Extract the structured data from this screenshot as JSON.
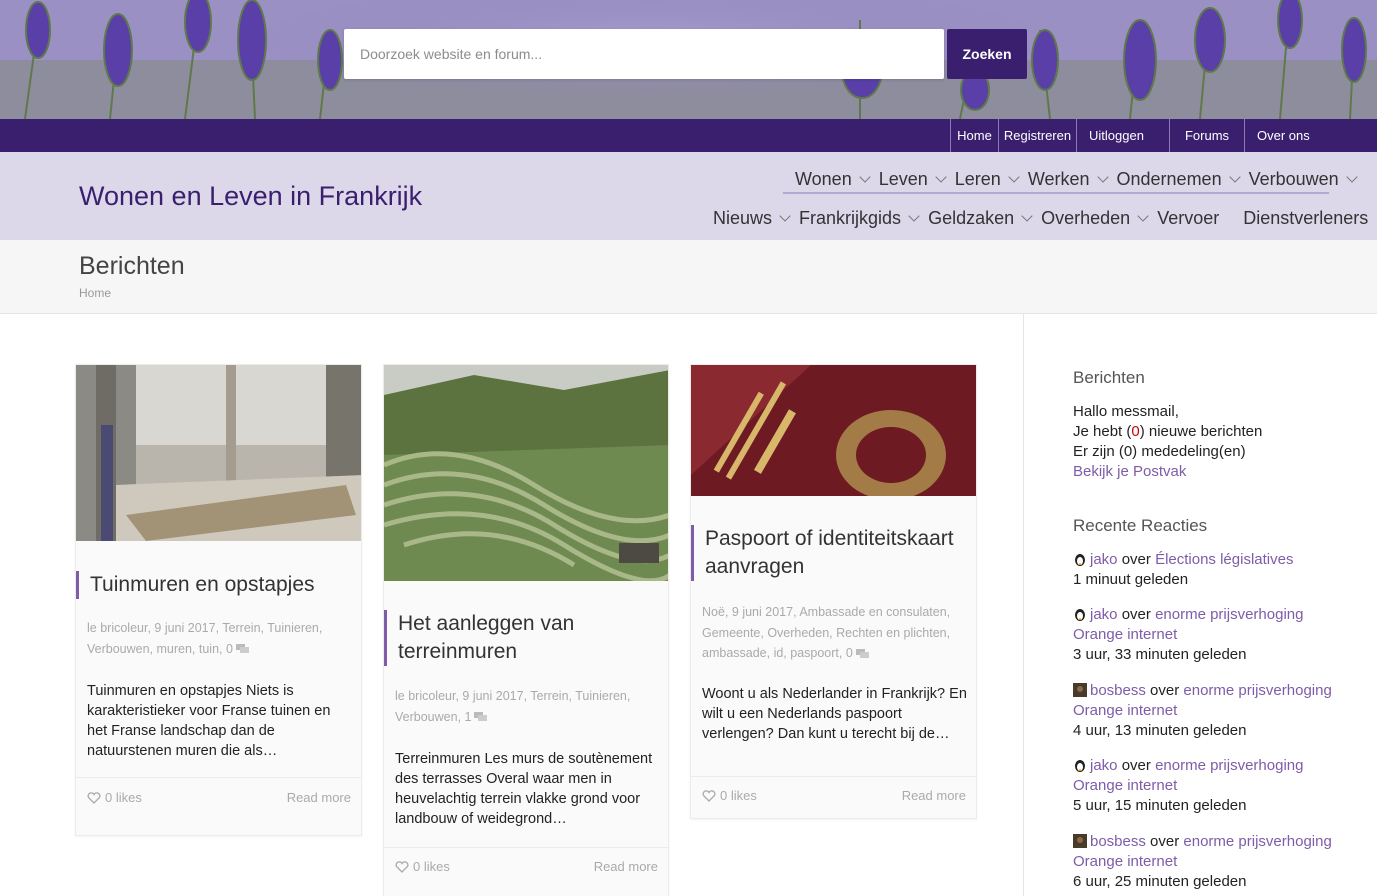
{
  "search": {
    "placeholder": "Doorzoek website en forum...",
    "button_label": "Zoeken"
  },
  "topnav": [
    "Home",
    "Registreren",
    "Uitloggen",
    "Forums",
    "Over ons"
  ],
  "site_title": "Wonen en Leven in Frankrijk",
  "mainnav_row1": [
    "Wonen",
    "Leven",
    "Leren",
    "Werken",
    "Ondernemen",
    "Verbouwen"
  ],
  "mainnav_row2": [
    "Nieuws",
    "Frankrijkgids",
    "Geldzaken",
    "Overheden",
    "Vervoer",
    "Dienstverleners"
  ],
  "page": {
    "title": "Berichten",
    "breadcrumb": "Home"
  },
  "cards": [
    {
      "title": "Tuinmuren en opstapjes",
      "author": "le bricoleur",
      "date": "9 juni 2017",
      "categories": "Terrein, Tuinieren, Verbouwen, muren, tuin",
      "comments": "0",
      "excerpt": "Tuinmuren en opstapjes Niets is karakteristieker voor Franse tuinen en het Franse landschap dan de natuurstenen muren die als…",
      "likes": "0 likes",
      "read_more": "Read more"
    },
    {
      "title": "Het aanleggen van terreinmuren",
      "author": "le bricoleur",
      "date": "9 juni 2017",
      "categories": "Terrein, Tuinieren, Verbouwen",
      "comments": "1",
      "excerpt": "Terreinmuren Les murs de soutènement des terrasses Overal waar men in heuvelachtig terrein vlakke grond voor landbouw of weidegrond…",
      "likes": "0 likes",
      "read_more": "Read more"
    },
    {
      "title": "Paspoort of identiteitskaart aanvragen",
      "author": "Noë",
      "date": "9 juni 2017",
      "categories": "Ambassade en consulaten, Gemeente, Overheden, Rechten en plichten, ambassade, id, paspoort",
      "comments": "0",
      "excerpt": "Woont u als Nederlander in Frankrijk? En wilt u een Nederlands paspoort verlengen? Dan kunt u terecht bij de…",
      "likes": "0 likes",
      "read_more": "Read more"
    }
  ],
  "sidebar": {
    "berichten_heading": "Berichten",
    "greeting": "Hallo messmail,",
    "new_msgs_prefix": "Je hebt (",
    "new_msgs_count": "0",
    "new_msgs_suffix": ") nieuwe berichten",
    "announcements": "Er zijn (0) mededeling(en)",
    "inbox_link": "Bekijk je Postvak",
    "reacties_heading": "Recente Reacties",
    "over_word": "over",
    "reacties": [
      {
        "user": "jako",
        "post": "Élections législatives",
        "time": "1 minuut geleden",
        "avatar": "penguin-icon"
      },
      {
        "user": "jako",
        "post": "enorme prijsverhoging Orange internet",
        "time": "3 uur, 33 minuten geleden",
        "avatar": "penguin-icon"
      },
      {
        "user": "bosbess",
        "post": "enorme prijsverhoging Orange internet",
        "time": "4 uur, 13 minuten geleden",
        "avatar": "photo-avatar"
      },
      {
        "user": "jako",
        "post": "enorme prijsverhoging Orange internet",
        "time": "5 uur, 15 minuten geleden",
        "avatar": "penguin-icon"
      },
      {
        "user": "bosbess",
        "post": "enorme prijsverhoging Orange internet",
        "time": "6 uur, 25 minuten geleden",
        "avatar": "photo-avatar"
      }
    ]
  },
  "colors": {
    "brand_purple": "#3b1f6f",
    "accent_purple": "#7e5ca8",
    "header_bg": "#dcd8ea",
    "new_count_red": "#c00"
  }
}
